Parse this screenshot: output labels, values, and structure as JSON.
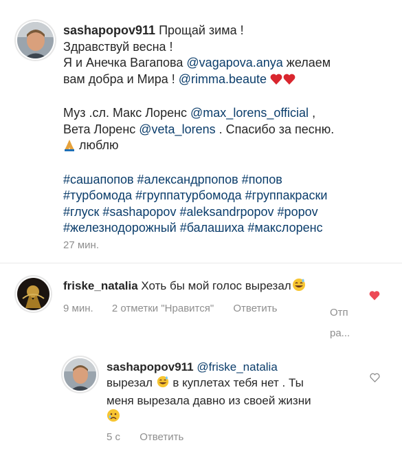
{
  "post": {
    "username": "sashapopov911",
    "line1_text": "Прощай зима !",
    "line2": "Здравствуй весна !",
    "line3_pre": "Я и Анечка Вагапова ",
    "line3_mention": "@vagapova.anya",
    "line3_post": " желаем",
    "line4_pre": "вам добра и Мира ! ",
    "line4_mention": "@rimma.beaute",
    "line5_pre": "Муз .сл. Макс Лоренс ",
    "line5_mention": "@max_lorens_official",
    "line5_post": " ,",
    "line6_pre": "Вета Лоренс ",
    "line6_mention": "@veta_lorens",
    "line6_post": " . Спасибо за песню.",
    "line7_post": " люблю",
    "hashtags": [
      "#сашапопов #александрпопов #попов",
      "#турбомода #группатурбомода #группакраски",
      "#глуск #sashapopov #aleksandrpopov #popov",
      "#железнодорожный #балашиха #макслоренс"
    ],
    "time": "27 мин."
  },
  "comment1": {
    "username": "friske_natalia",
    "text": " Хоть бы мой голос вырезал",
    "time": "9 мин.",
    "likes": "2 отметки \"Нравится\"",
    "reply": "Ответить",
    "more_1": "Отп",
    "more_2": "ра..."
  },
  "reply1": {
    "username": "sashapopov911",
    "mention": "@friske_natalia",
    "line2_pre": "вырезал ",
    "line2_post": " в куплетах тебя нет . Ты",
    "line3": "меня вырезала давно из своей жизни",
    "time": "5 с",
    "reply": "Ответить"
  },
  "icons": {
    "liked_heart_color": "#ed4956",
    "link_color": "#0b3d6b",
    "meta_color": "#8e8e8e"
  }
}
